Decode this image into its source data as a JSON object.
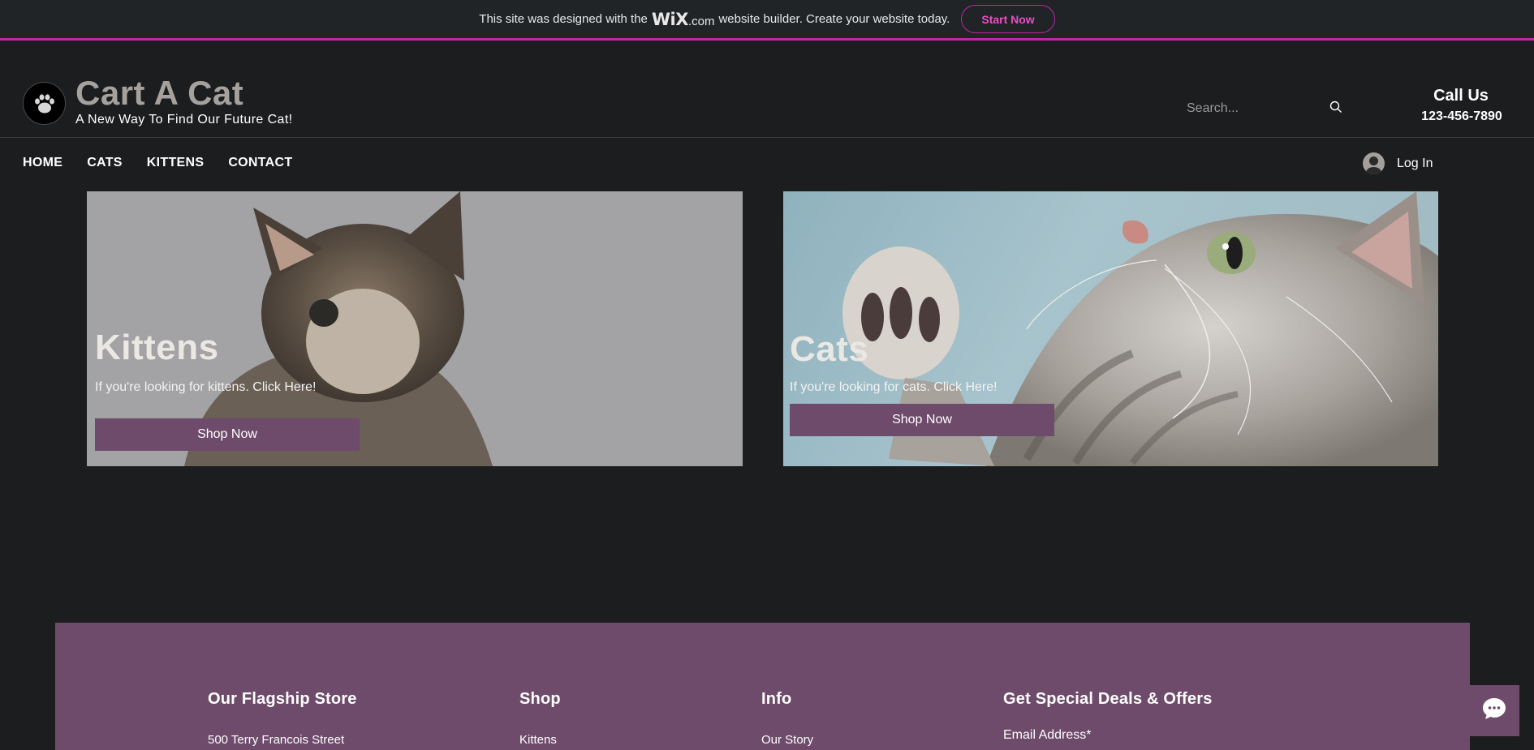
{
  "banner": {
    "text_before": "This site was designed with the",
    "wix_logo": "WiX",
    "wix_domain": ".com",
    "text_after": "website builder. Create your website today.",
    "cta_label": "Start Now",
    "accent_color": "#c026a7"
  },
  "header": {
    "logo_icon": "paw-icon",
    "site_title": "Cart A Cat",
    "tagline": "A New Way To Find Our Future Cat!",
    "search_placeholder": "Search...",
    "call_title": "Call Us",
    "phone": "123-456-7890"
  },
  "nav": {
    "items": [
      {
        "label": "HOME"
      },
      {
        "label": "CATS"
      },
      {
        "label": "KITTENS"
      },
      {
        "label": "CONTACT"
      }
    ],
    "login_label": "Log In"
  },
  "hero": {
    "kittens": {
      "title": "Kittens",
      "description": "If you're looking for kittens. Click Here!",
      "button": "Shop Now"
    },
    "cats": {
      "title": "Cats",
      "description": "If you're looking for cats. Click Here!",
      "button": "Shop Now"
    }
  },
  "footer": {
    "store": {
      "heading": "Our Flagship Store",
      "line1": "500 Terry Francois Street"
    },
    "shop": {
      "heading": "Shop",
      "item1": "Kittens"
    },
    "info": {
      "heading": "Info",
      "item1": "Our Story"
    },
    "deals": {
      "heading": "Get Special Deals & Offers",
      "field_label": "Email Address*"
    }
  },
  "colors": {
    "background": "#1c1d1f",
    "brand_purple": "#6e4b6b",
    "title_gray": "#a5a19c"
  }
}
